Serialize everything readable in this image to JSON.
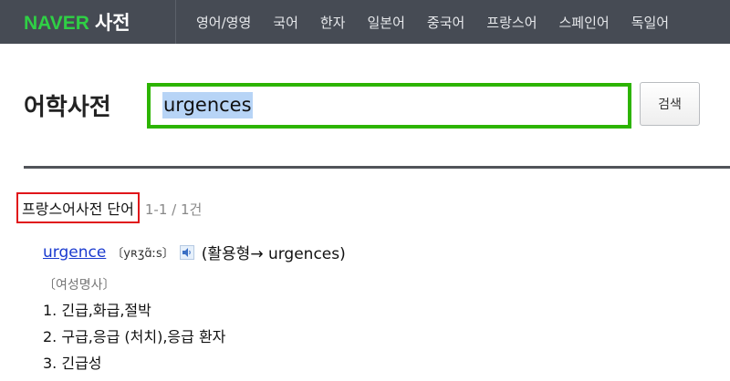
{
  "header": {
    "logo_main": "NAVER",
    "logo_sub": "사전",
    "nav": [
      "영어/영영",
      "국어",
      "한자",
      "일본어",
      "중국어",
      "프랑스어",
      "스페인어",
      "독일어"
    ]
  },
  "page": {
    "title": "어학사전"
  },
  "search": {
    "value": "urgences",
    "button_label": "검색"
  },
  "results": {
    "section_title": "프랑스어사전 단어",
    "count": "1-1 / 1건",
    "entry": {
      "headword": "urgence",
      "pronunciation": "〔yʀʒɑ̃ːs〕",
      "inflection": "(활용형→ urgences)",
      "part_of_speech": "〔여성명사〕",
      "meanings": [
        "1. 긴급,화급,절박",
        "2. 구급,응급 (처치),응급 환자",
        "3. 긴급성"
      ]
    }
  }
}
